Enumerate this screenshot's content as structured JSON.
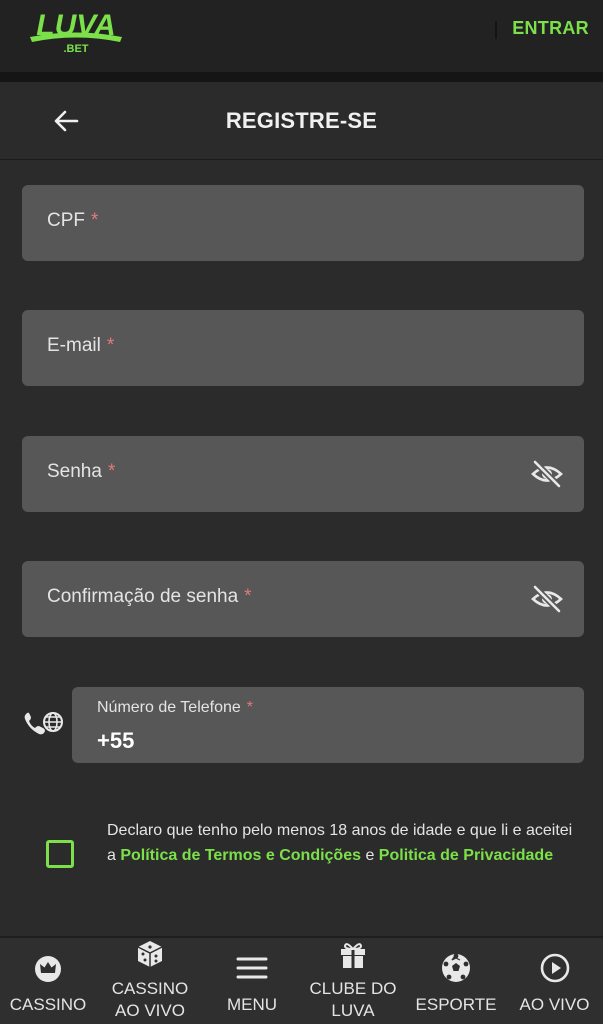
{
  "header": {
    "logo_text": "LUVA",
    "logo_subtext": ".BET",
    "login_label": "ENTRAR"
  },
  "titlebar": {
    "title": "REGISTRE-SE"
  },
  "form": {
    "cpf_label": "CPF",
    "email_label": "E-mail",
    "password_label": "Senha",
    "confirm_password_label": "Confirmação de senha",
    "required_mark": "*",
    "phone": {
      "label": "Número de Telefone",
      "value": "+55"
    }
  },
  "consent": {
    "text_before": "Declaro que tenho pelo menos 18 anos de idade e que li e aceitei a ",
    "terms_link": "Política de Termos e Condições",
    "text_middle": " e ",
    "privacy_link": "Politica de Privacidade",
    "checked": false
  },
  "nav": {
    "items": [
      {
        "label": "CASSINO",
        "icon": "crown-icon"
      },
      {
        "label": "CASSINO\nAO VIVO",
        "icon": "dice-icon"
      },
      {
        "label": "MENU",
        "icon": "hamburger-icon"
      },
      {
        "label": "CLUBE DO\nLUVA",
        "icon": "gift-icon"
      },
      {
        "label": "ESPORTE",
        "icon": "soccer-ball-icon"
      },
      {
        "label": "AO VIVO",
        "icon": "play-circle-icon"
      }
    ]
  },
  "colors": {
    "accent": "#7be04a",
    "background": "#2b2b2b",
    "header": "#222222",
    "field": "#575757",
    "required": "#e07a7a"
  }
}
